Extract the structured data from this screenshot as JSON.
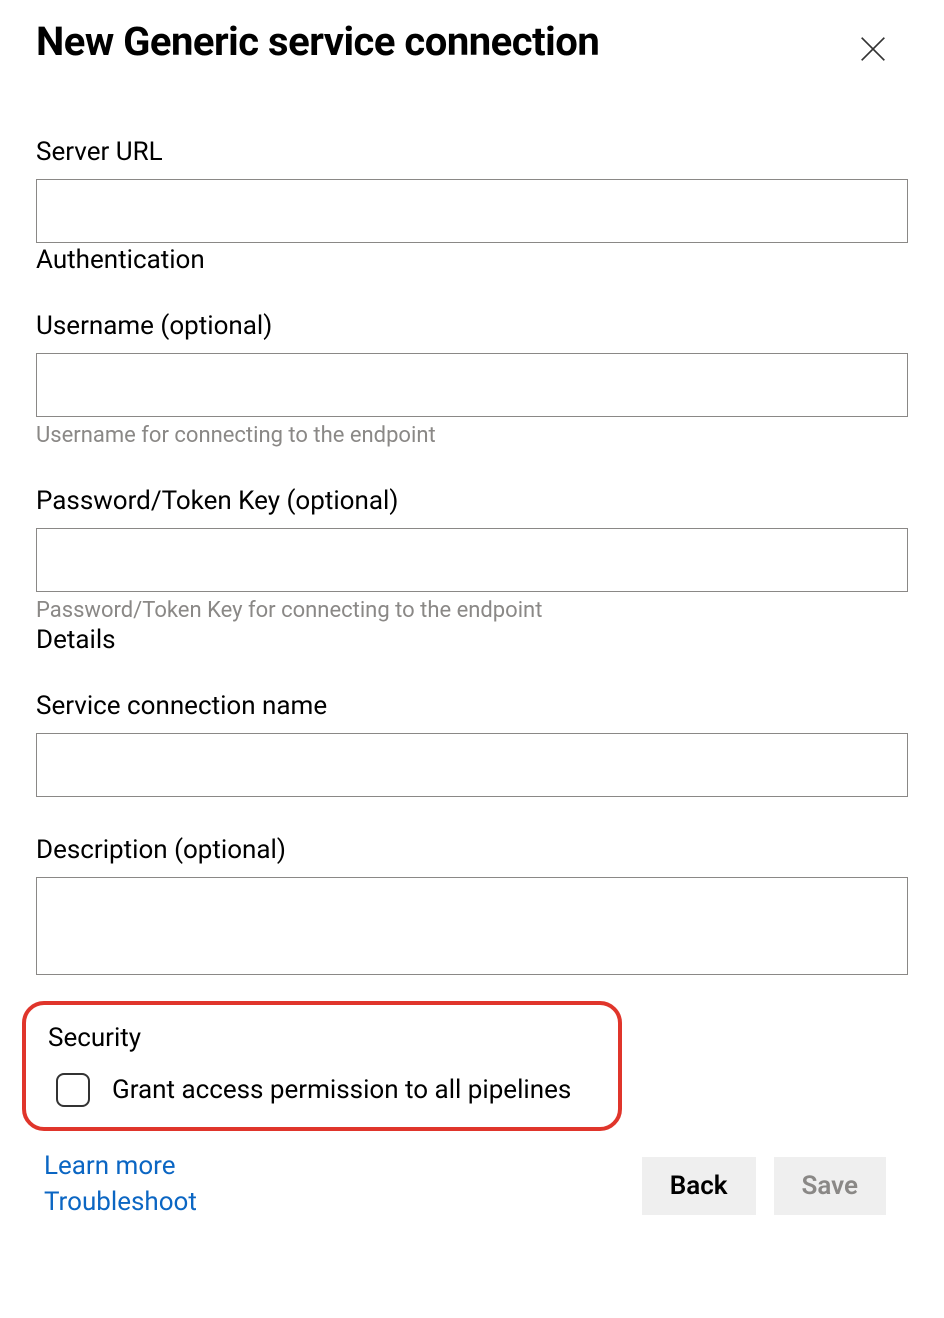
{
  "header": {
    "title": "New Generic service connection"
  },
  "fields": {
    "server_url": {
      "label": "Server URL",
      "value": ""
    },
    "auth_section": "Authentication",
    "username": {
      "label": "Username (optional)",
      "value": "",
      "helper": "Username for connecting to the endpoint"
    },
    "password": {
      "label": "Password/Token Key (optional)",
      "value": "",
      "helper": "Password/Token Key for connecting to the endpoint"
    },
    "details_section": "Details",
    "name": {
      "label": "Service connection name",
      "value": ""
    },
    "description": {
      "label": "Description (optional)",
      "value": ""
    }
  },
  "security": {
    "heading": "Security",
    "grant_label": "Grant access permission to all pipelines",
    "grant_checked": false
  },
  "footer": {
    "learn_more": "Learn more",
    "troubleshoot": "Troubleshoot",
    "back": "Back",
    "save": "Save"
  }
}
